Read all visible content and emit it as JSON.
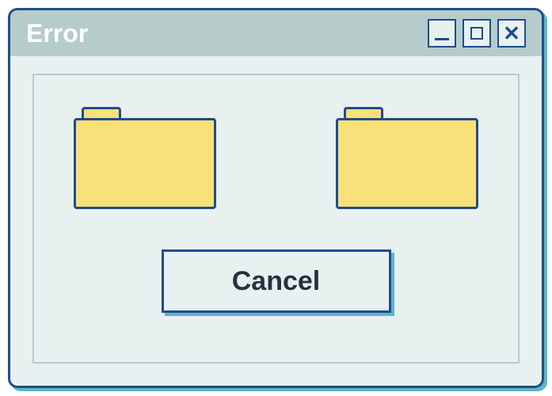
{
  "window": {
    "title": "Error"
  },
  "icons": {
    "left": "folder-icon",
    "right": "folder-icon"
  },
  "buttons": {
    "cancel_label": "Cancel"
  },
  "colors": {
    "border": "#1e4d8b",
    "background": "#e8f0f0",
    "titlebar": "#b5ccca",
    "folder": "#f9e179",
    "shadow": "#5eb5c4"
  }
}
